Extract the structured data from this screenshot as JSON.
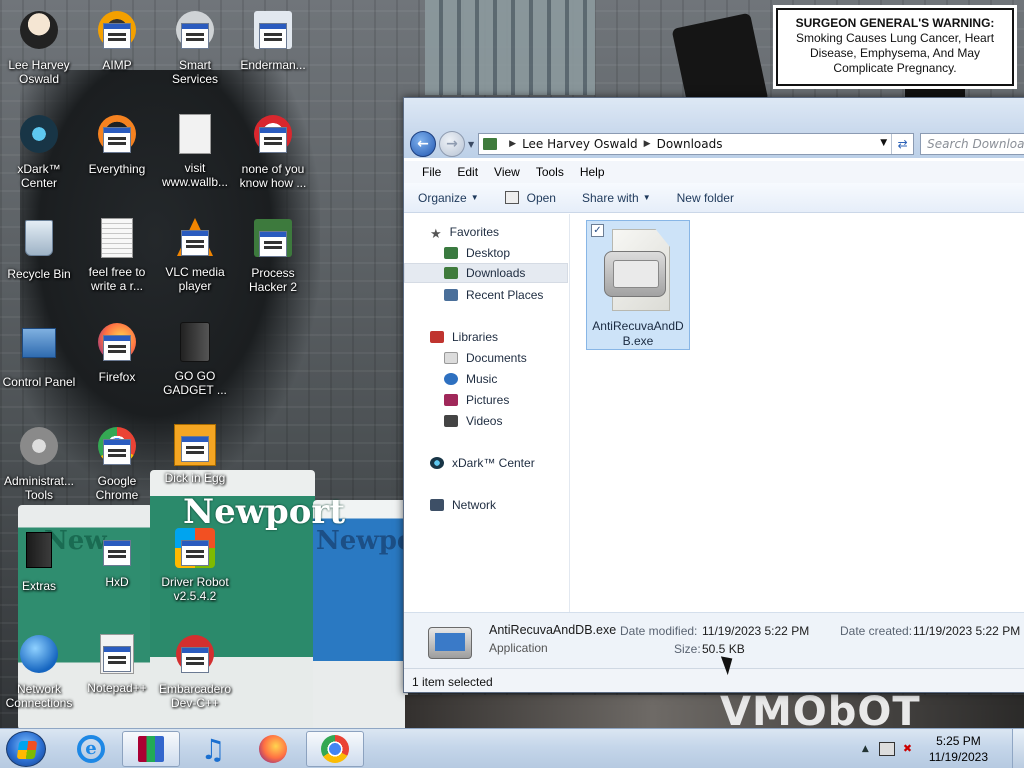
{
  "warning": {
    "heading": "SURGEON GENERAL'S WARNING:",
    "text": "Smoking Causes Lung Cancer, Heart Disease, Emphysema, And May Complicate Pregnancy."
  },
  "wallpaper": {
    "box_brand": "Newport",
    "box_brand_short": "Newpo",
    "box_brand_left": "New",
    "bottom_text": "VMObOT"
  },
  "desktop_icons": [
    {
      "label": "Lee Harvey Oswald",
      "icon": "user-folder-icon"
    },
    {
      "label": "AIMP",
      "icon": "exe-icon"
    },
    {
      "label": "Smart Services",
      "icon": "exe-icon"
    },
    {
      "label": "Enderman...",
      "icon": "exe-icon"
    },
    {
      "label": "xDark™ Center",
      "icon": "xdark-icon"
    },
    {
      "label": "Everything",
      "icon": "exe-icon"
    },
    {
      "label": "visit www.wallb...",
      "icon": "document-icon"
    },
    {
      "label": "none of you know how ...",
      "icon": "exe-icon"
    },
    {
      "label": "Recycle Bin",
      "icon": "recycle-bin-icon"
    },
    {
      "label": "feel free to write a r...",
      "icon": "text-file-icon"
    },
    {
      "label": "VLC media player",
      "icon": "exe-icon"
    },
    {
      "label": "Process Hacker 2",
      "icon": "exe-icon"
    },
    {
      "label": "Control Panel",
      "icon": "control-panel-icon"
    },
    {
      "label": "Firefox",
      "icon": "exe-icon"
    },
    {
      "label": "GO GO GADGET ...",
      "icon": "gadget-icon"
    },
    {
      "label": "Administrat... Tools",
      "icon": "admin-tools-icon"
    },
    {
      "label": "Google Chrome",
      "icon": "exe-icon"
    },
    {
      "label": "Dick in Egg",
      "icon": "exe-icon"
    },
    {
      "label": "Extras",
      "icon": "folder-icon"
    },
    {
      "label": "HxD",
      "icon": "exe-icon"
    },
    {
      "label": "Driver Robot v2.5.4.2",
      "icon": "exe-icon"
    },
    {
      "label": "Network Connections",
      "icon": "network-icon"
    },
    {
      "label": "Notepad++",
      "icon": "exe-icon"
    },
    {
      "label": "Embarcadero Dev-C++",
      "icon": "exe-icon"
    }
  ],
  "explorer": {
    "address": {
      "root": "Lee Harvey Oswald",
      "current": "Downloads"
    },
    "search_placeholder": "Search Downloads",
    "menu": [
      "File",
      "Edit",
      "View",
      "Tools",
      "Help"
    ],
    "toolbar": {
      "organize": "Organize",
      "open": "Open",
      "share_with": "Share with",
      "new_folder": "New folder"
    },
    "nav": {
      "favorites": "Favorites",
      "desktop": "Desktop",
      "downloads": "Downloads",
      "recent_places": "Recent Places",
      "libraries": "Libraries",
      "documents": "Documents",
      "music": "Music",
      "pictures": "Pictures",
      "videos": "Videos",
      "xdark_center": "xDark™ Center",
      "network": "Network"
    },
    "file": {
      "name_line1": "AntiRecuvaAndD",
      "name_line2": "B.exe"
    },
    "details": {
      "name": "AntiRecuvaAndDB.exe",
      "type": "Application",
      "date_modified_label": "Date modified:",
      "date_modified": "11/19/2023 5:22 PM",
      "date_created_label": "Date created:",
      "date_created": "11/19/2023 5:22 PM",
      "size_label": "Size:",
      "size": "50.5 KB"
    },
    "status": "1 item selected"
  },
  "taskbar": {
    "time": "5:25 PM",
    "date": "11/19/2023"
  }
}
